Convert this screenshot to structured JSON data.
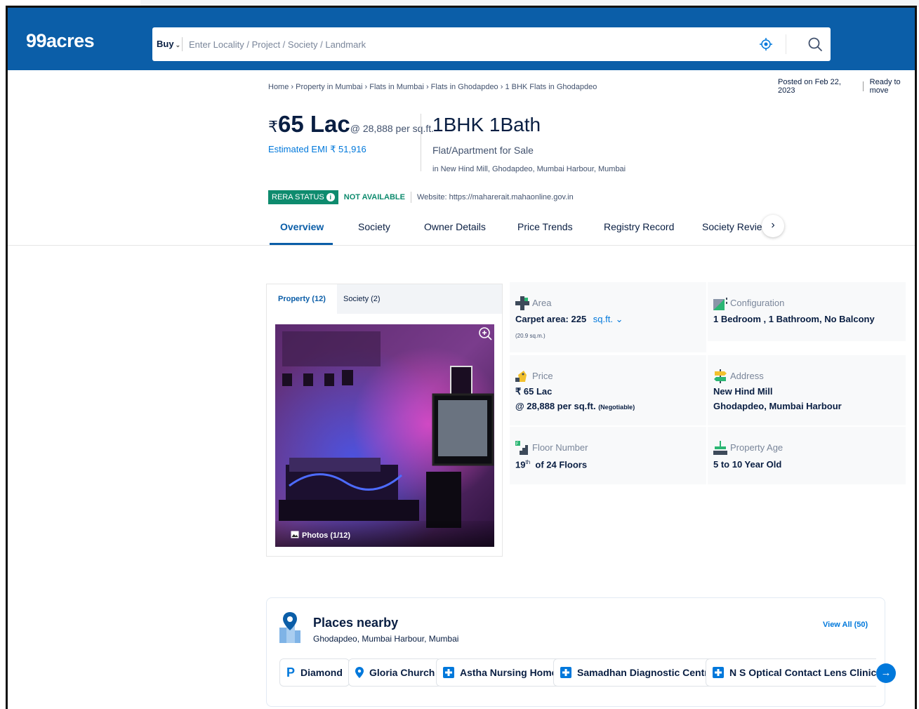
{
  "header": {
    "logo": "99acres",
    "search": {
      "buy_label": "Buy",
      "placeholder": "Enter Locality / Project / Society / Landmark",
      "value": "",
      "locate_icon": "locate-icon",
      "search_icon": "search-icon"
    }
  },
  "breadcrumb": "Home › Property in Mumbai › Flats in Mumbai › Flats in Ghodapdeo › 1 BHK Flats in Ghodapdeo",
  "posted": {
    "date": "Posted on Feb 22, 2023",
    "status": "Ready to move"
  },
  "listing": {
    "currency": "₹",
    "price": "65 Lac",
    "price_per_sqft": "@ 28,888 per sq.ft.",
    "emi": "Estimated EMI ₹ 51,916",
    "title": "1BHK 1Bath",
    "type": "Flat/Apartment for Sale",
    "location": "in New Hind Mill, Ghodapdeo, Mumbai Harbour, Mumbai"
  },
  "rera": {
    "badge": "RERA STATUS",
    "status": "NOT AVAILABLE",
    "website": "Website: https://maharerait.mahaonline.gov.in"
  },
  "tabs": [
    {
      "label": "Overview",
      "active": true
    },
    {
      "label": "Society",
      "active": false
    },
    {
      "label": "Owner Details",
      "active": false
    },
    {
      "label": "Price Trends",
      "active": false
    },
    {
      "label": "Registry Record",
      "active": false
    },
    {
      "label": "Society Reviews",
      "active": false
    }
  ],
  "gallery": {
    "tabs": [
      "Property (12)",
      "Society (2)"
    ],
    "photo_count": "Photos (1/12)"
  },
  "details": {
    "area": {
      "label": "Area",
      "value": "Carpet area: 225",
      "unit": "sq.ft.",
      "sub": "(20.9 sq.m.)"
    },
    "configuration": {
      "label": "Configuration",
      "value": "1 Bedroom , 1 Bathroom, No Balcony"
    },
    "price": {
      "label": "Price",
      "value": "₹ 65 Lac",
      "value2": "@ 28,888 per sq.ft.",
      "note": "(Negotiable)"
    },
    "address": {
      "label": "Address",
      "value": "New Hind Mill",
      "value2": "Ghodapdeo, Mumbai Harbour"
    },
    "floor": {
      "label": "Floor Number",
      "value": "19",
      "sup": "th",
      "value_rest": "of 24 Floors"
    },
    "age": {
      "label": "Property Age",
      "value": "5 to 10 Year Old"
    }
  },
  "places": {
    "title": "Places nearby",
    "subtitle": "Ghodapdeo, Mumbai Harbour, Mumbai",
    "view_all": "View All (50)",
    "items": [
      {
        "label": "Diamond",
        "icon": "parking-icon"
      },
      {
        "label": "Gloria Church",
        "icon": "location-pin-icon"
      },
      {
        "label": "Astha Nursing Home",
        "icon": "hospital-icon"
      },
      {
        "label": "Samadhan Diagnostic Centre",
        "icon": "hospital-icon"
      },
      {
        "label": "N S Optical Contact Lens Clinic Ghat",
        "icon": "hospital-icon"
      }
    ]
  },
  "colors": {
    "brand": "#0b5ea8",
    "link": "#0078db",
    "rera_green": "#0e8b6e"
  }
}
